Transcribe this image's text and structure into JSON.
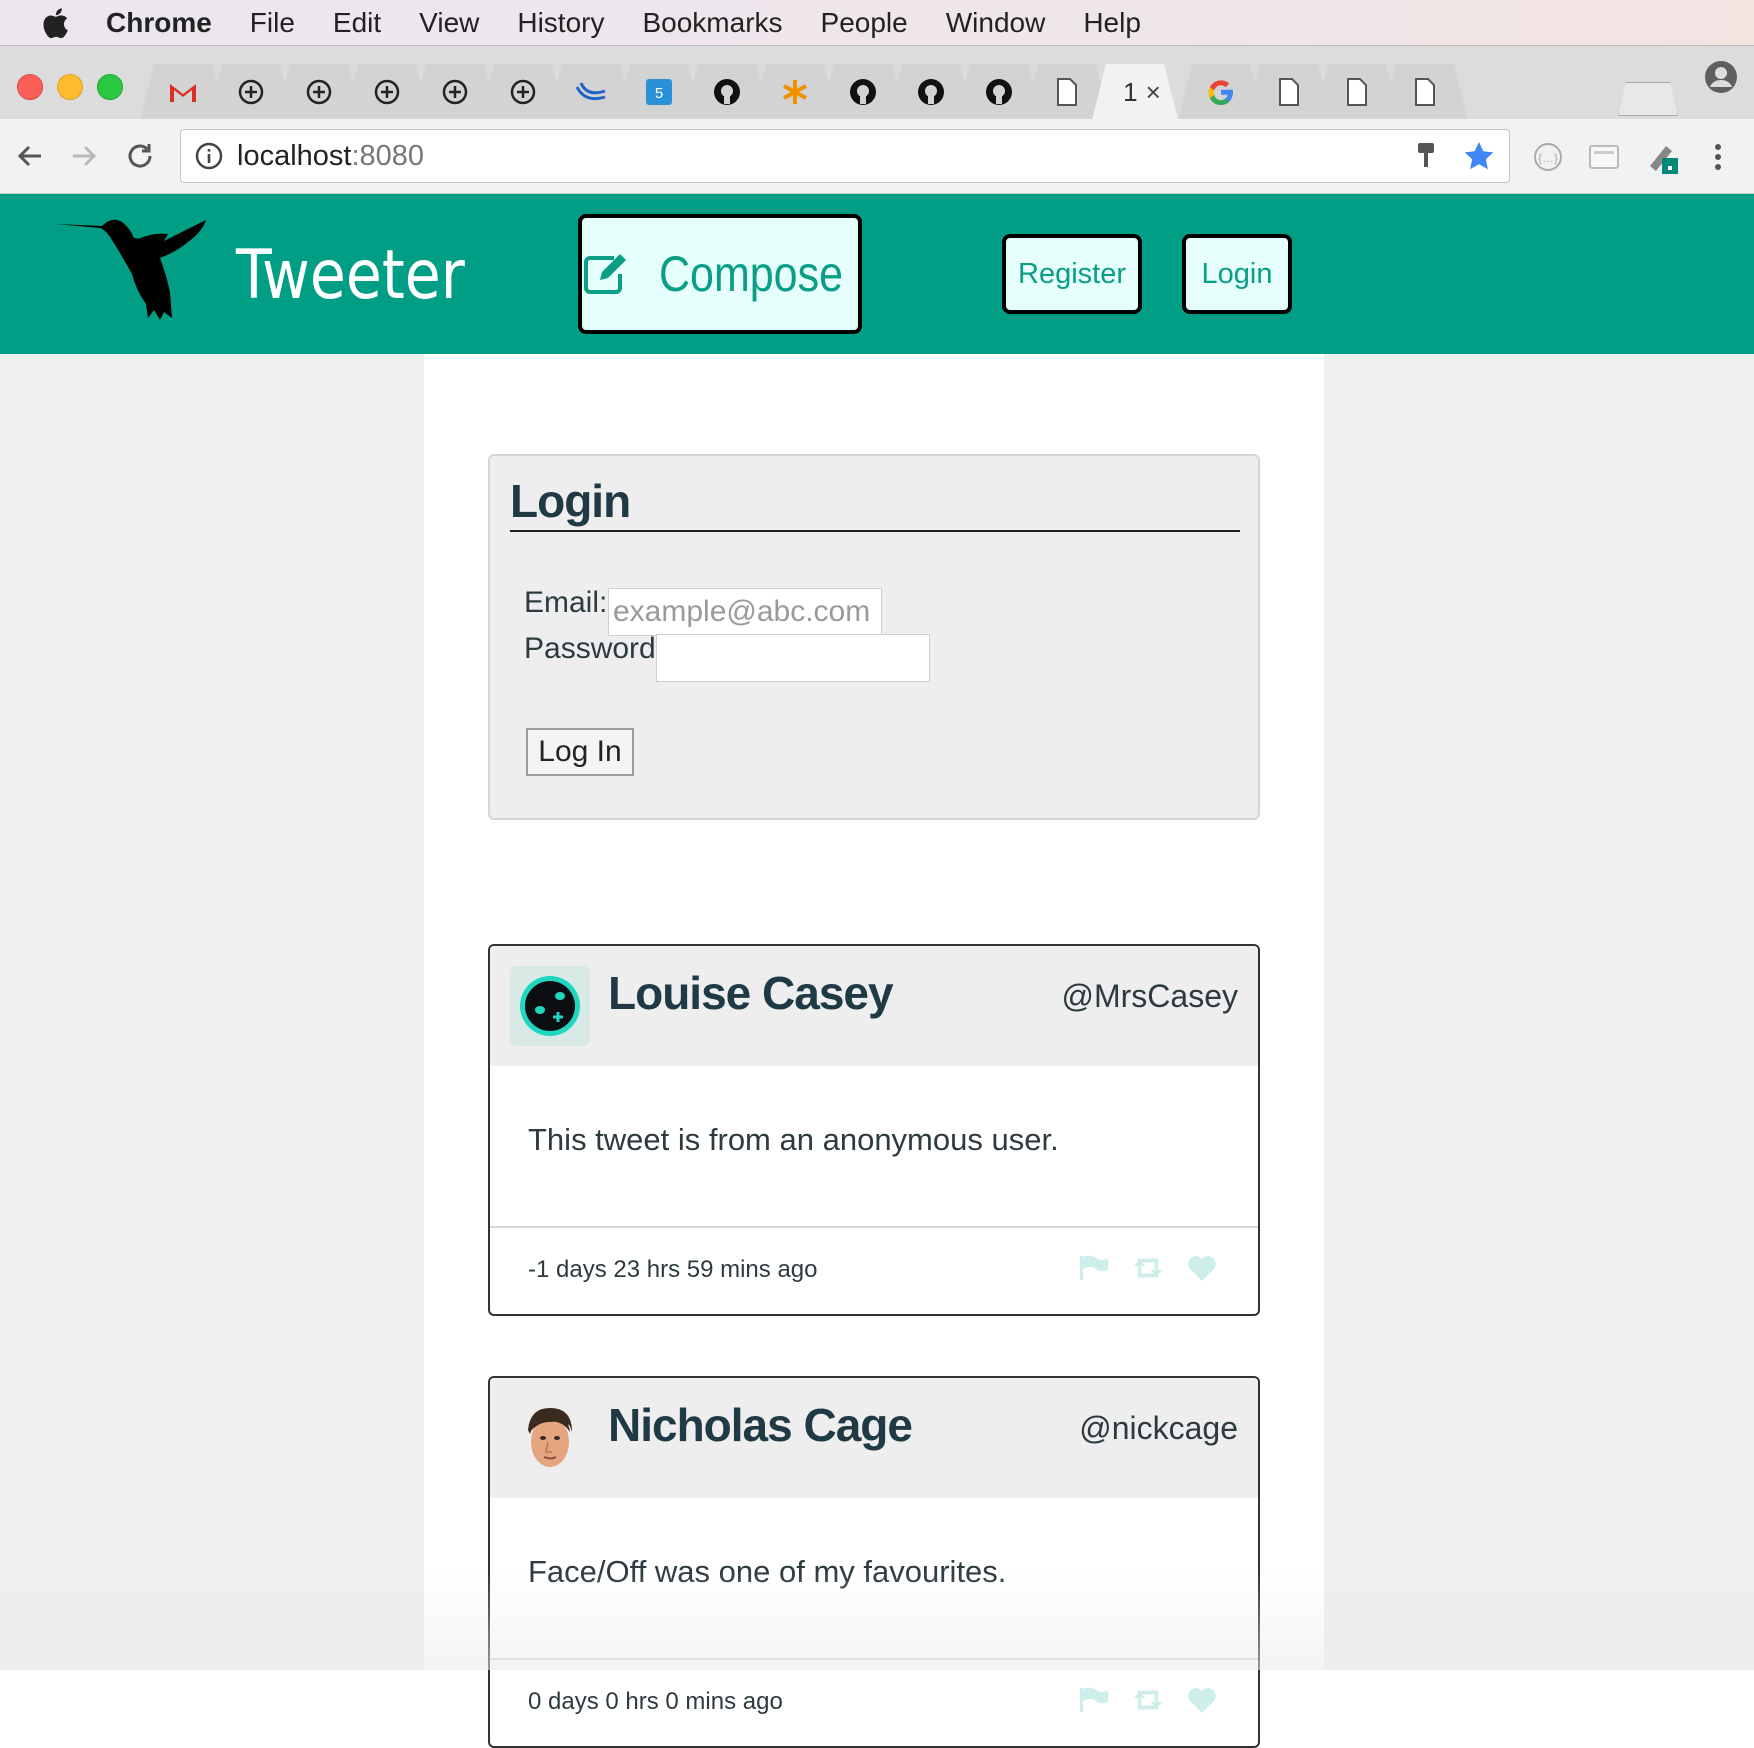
{
  "menubar": {
    "app_name": "Chrome",
    "items": [
      "File",
      "Edit",
      "View",
      "History",
      "Bookmarks",
      "People",
      "Window",
      "Help"
    ]
  },
  "browser": {
    "active_tab_label": "1",
    "url_host": "localhost",
    "url_port": ":8080",
    "tab_icons": [
      "gmail-icon",
      "circle-plus-icon",
      "circle-plus-icon",
      "circle-plus-icon",
      "circle-plus-icon",
      "circle-plus-icon",
      "wave-icon",
      "html5-icon",
      "github-icon",
      "asterisk-icon",
      "github-icon",
      "github-icon",
      "github-icon",
      "document-icon",
      "active-tab",
      "google-icon",
      "document-icon",
      "document-icon",
      "document-icon"
    ]
  },
  "header": {
    "brand": "Tweeter",
    "compose_label": "Compose",
    "register_label": "Register",
    "login_label": "Login",
    "color": "#009e84"
  },
  "login_form": {
    "title": "Login",
    "email_label": "Email:",
    "email_placeholder": "example@abc.com",
    "email_value": "",
    "password_label": "Password:",
    "password_value": "",
    "submit_label": "Log In"
  },
  "tweets": [
    {
      "name": "Louise Casey",
      "handle": "@MrsCasey",
      "body": "This tweet is from an anonymous user.",
      "time": "-1 days 23 hrs 59 mins ago"
    },
    {
      "name": "Nicholas Cage",
      "handle": "@nickcage",
      "body": "Face/Off was one of my favourites.",
      "time": "0 days 0 hrs 0 mins ago"
    }
  ]
}
